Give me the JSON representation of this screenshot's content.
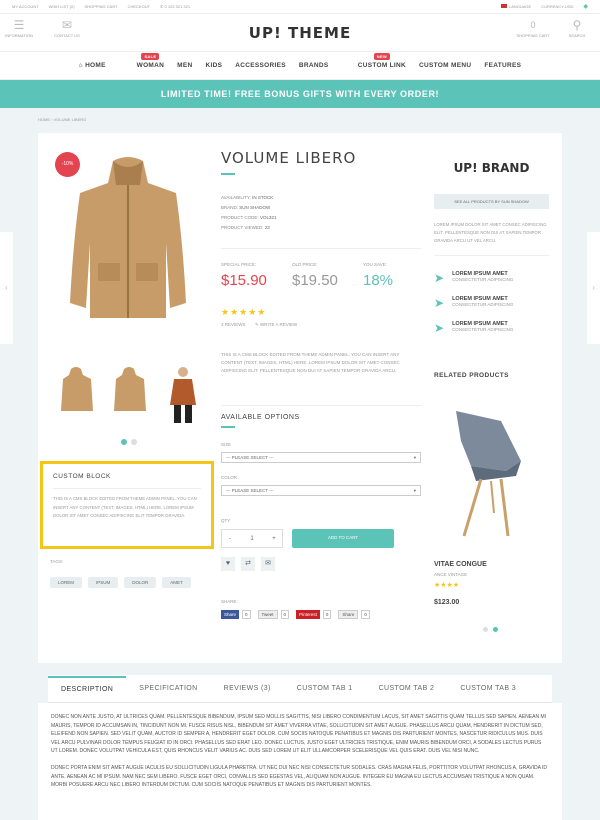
{
  "topbar": {
    "account": "MY ACCOUNT",
    "wishlist": "WISH LIST (0)",
    "cart": "SHOPPING CART",
    "checkout": "CHECKOUT",
    "phone": "0 123 321 321",
    "language": "LANGUAGE",
    "currency": "CURRENCY USD"
  },
  "header": {
    "logo": "UP! THEME",
    "information": "INFORMATION",
    "contact": "CONTACT US",
    "cart": "SHOPPING CART",
    "search": "SEARCH",
    "cart_count": "0"
  },
  "nav": {
    "items": [
      "HOME",
      "WOMAN",
      "MEN",
      "KIDS",
      "ACCESSORIES",
      "BRANDS",
      "CUSTOM LINK",
      "CUSTOM MENU",
      "FEATURES"
    ],
    "sale_badge": "SALE",
    "new_badge": "NEW"
  },
  "promo": "LIMITED TIME! FREE BONUS GIFTS WITH EVERY ORDER!",
  "breadcrumb": {
    "home": "HOME",
    "current": "VOLUME LIBERO"
  },
  "product": {
    "discount": "-10%",
    "title": "VOLUME LIBERO",
    "availability_label": "AVAILABILITY:",
    "availability": "IN STOCK",
    "brand_label": "BRAND:",
    "brand": "SUN SHADOW",
    "code_label": "PRODUCT CODE:",
    "code": "VOL321",
    "viewed_label": "PRODUCT VIEWED:",
    "viewed": "23",
    "special_label": "SPECIAL PRICE:",
    "special": "$15.90",
    "old_label": "OLD PRICE:",
    "old": "$19.50",
    "save_label": "YOU SAVE:",
    "save": "18%",
    "rating": 5,
    "stars": "★★★★★",
    "reviews": "3 REVIEWS",
    "write_review": "WRITE A REVIEW",
    "cms": "THIS IS A CMS BLOCK EDITED FROM THEME ADMIN PANEL. YOU CAN INSERT ANY CONTENT (TEXT, IMAGES, HTML) HERE. LOREM IPSUM DOLOR SIT AMET CONSEC ADIPISCING ELIT. PELLENTESQUE NON DUI AT SAPIEN TEMPOR GRAVIDA ARCU.",
    "options_title": "AVAILABLE OPTIONS",
    "size_label": "SIZE",
    "color_label": "COLOR",
    "select_placeholder": "--- PLEASE SELECT ---",
    "qty_label": "QTY",
    "qty": "1",
    "minus": "-",
    "plus": "+",
    "add_to_cart": "ADD TO CART",
    "share_label": "SHARE:",
    "share": {
      "fb": "Share",
      "tw": "Tweet",
      "pin": "Pinterest",
      "gp": "Share",
      "count": "0"
    }
  },
  "custom_block": {
    "title": "CUSTOM BLOCK",
    "text": "THIS IS A CMS BLOCK EDITED FROM THEME ADMIN PANEL. YOU CAN INSERT ANY CONTENT (TEXT, IMAGES, HTML) HERE. LOREM IPSUM DOLOR SIT AMET CONSEC ADIPISCING ELIT TEMPOR GRAVIDA."
  },
  "tags": {
    "label": "TAGS:",
    "items": [
      "LOREM",
      "IPSUM",
      "DOLOR",
      "AMET"
    ]
  },
  "brand_panel": {
    "logo": "UP! BRAND",
    "button": "SEE ALL PRODUCTS BY SUN SHADOW",
    "text": "LOREM IPSUM DOLOR SIT AMET CONSEC ADIPISCING ELIT. PELLENTESQUE NON DUI AT SAPIEN TEMPOR GRAVIDA ARCU UT VEL ARCU.",
    "features": [
      {
        "title": "LOREM IPSUM AMET",
        "sub": "CONSECTETUR ADIPISCING"
      },
      {
        "title": "LOREM IPSUM AMET",
        "sub": "CONSECTETUR ADIPISCING"
      },
      {
        "title": "LOREM IPSUM AMET",
        "sub": "CONSECTETUR ADIPISCING"
      }
    ]
  },
  "related": {
    "title": "RELATED PRODUCTS",
    "name": "VITAE CONGUE",
    "brand": "ANCE VINTAGE",
    "stars": "★★★★",
    "rating": 4,
    "price": "$123.00"
  },
  "tabs": [
    "DESCRIPTION",
    "SPECIFICATION",
    "REVIEWS (3)",
    "CUSTOM TAB 1",
    "CUSTOM TAB 2",
    "CUSTOM TAB 3"
  ],
  "description": {
    "p1": "DONEC NON ANTE JUSTO, AT ULTRICES QUAM. PELLENTESQUE BIBENDUM, IPSUM SED MOLLIS SAGITTIS, NISI LIBERO CONDIMENTUM LACUS, SIT AMET SAGITTIS QUAM TELLUS SED SAPIEN. AENEAN MI MAURIS, TEMPOR ID ACCUMSAN IN, TINCIDUNT NON MI. FUSCE RISUS NISL, BIBENDUM SIT AMET VIVERRA VITAE, SOLLICITUDIN SIT AMET AUGUE. PHASELLUS ARCU QUAM, HENDRERIT IN DICTUM SED, ELEIFEND NON SAPIEN. SED VELIT QUAM, AUCTOR ID SEMPER A, HENDRERIT EGET DOLOR. CUM SOCIIS NATOQUE PENATIBUS ET MAGNIS DIS PARTURIENT MONTES, NASCETUR RIDICULUS MUS. DUIS VEL ARCU PULVINAR DOLOR TEMPUS FEUGIAT ID IN ORCI. PHASELLUS SED ERAT LEO. DONEC LUCTUS, JUSTO EGET ULTRICIES TRISTIQUE, ENIM MAURIS BIBENDUM ORCI, A SODALES LECTUS PURUS UT LOREM. DONEC VOLUTPAT VEHICULA EST, QUIS RHONCUS VELIT VARIUS AC. DUIS SED LOREM UT ELIT ULLAMCORPER SCELERISQUE VEL QUIS ERAT. DUIS VEL NISI NUNC.",
    "p2": "DONEC PORTA ENIM SIT AMET AUGUE IACULIS EU SOLLICITUDIN LIGULA PHARETRA. UT NEC DUI NEC NISI CONSECTETUR SODALES. CRAS MAGNA FELIS, PORTTITOR VOLUTPAT RHONCUS A, GRAVIDA ID ANTE. AENEAN AC MI IPSUM. NAM NEC SEM LIBERO. FUSCE EGET ORCI, CONVALLIS SED EGESTAS VEL, ALIQUAM NON AUGUE. INTEGER EU MAGNA EU LECTUS ACCUMSAN TRISTIQUE A NON QUAM. MORBI POSUERE ARCU NEC LIBERO INTERDUM DICTUM. CUM SOCIIS NATOQUE PENATIBUS ET MAGNIS DIS PARTURIENT MONTES."
  },
  "colors": {
    "accent": "#5cc3b8",
    "price": "#e3444f",
    "highlight": "#f5c518"
  }
}
